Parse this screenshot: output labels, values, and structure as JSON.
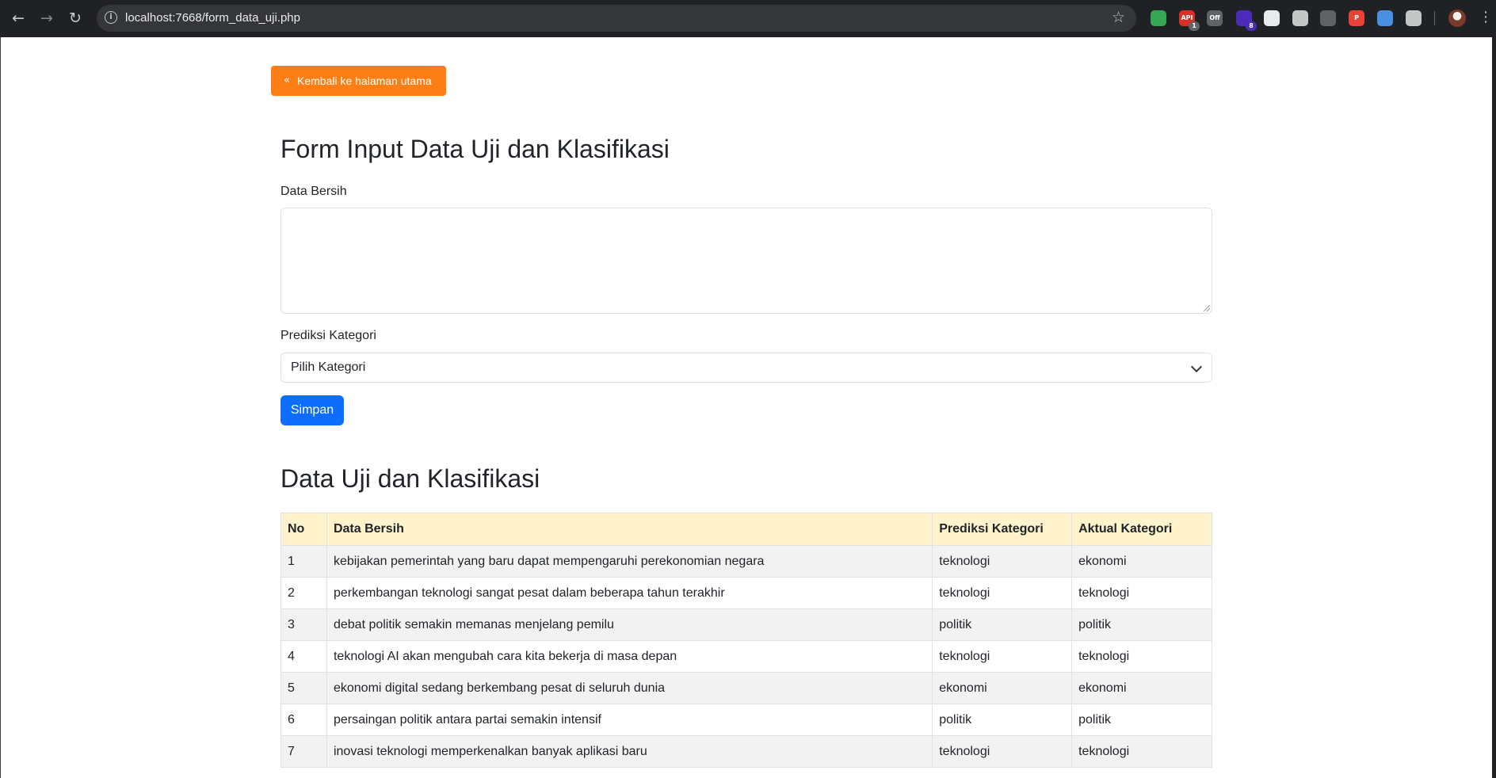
{
  "browser": {
    "url": "localhost:7668/form_data_uji.php",
    "extensions": [
      {
        "name": "green-extension",
        "color": "#34a853",
        "badge": ""
      },
      {
        "name": "api-extension",
        "color": "#d93025",
        "badge": "1",
        "label": "API"
      },
      {
        "name": "off-extension",
        "color": "#5f6368",
        "badge": "",
        "label": "Off"
      },
      {
        "name": "purple-extension",
        "color": "#4b2bb8",
        "badge": "8"
      },
      {
        "name": "terminal-extension",
        "color": "#e8eaed",
        "badge": ""
      },
      {
        "name": "target-extension",
        "color": "#c4c7c5",
        "badge": ""
      },
      {
        "name": "robot-extension",
        "color": "#5f6368",
        "badge": ""
      },
      {
        "name": "p-extension",
        "color": "#ea4335",
        "badge": "",
        "label": "P"
      },
      {
        "name": "blue-extension",
        "color": "#4a90e2",
        "badge": ""
      },
      {
        "name": "puzzle-extension",
        "color": "#c4c7c5",
        "badge": ""
      }
    ]
  },
  "back_button": {
    "label": "Kembali ke halaman utama",
    "icon": "double-chevron-left-icon",
    "color": "#fd7e14"
  },
  "form": {
    "title": "Form Input Data Uji dan Klasifikasi",
    "data_label": "Data Bersih",
    "data_value": "",
    "category_label": "Prediksi Kategori",
    "category_selected": "Pilih Kategori",
    "submit_label": "Simpan",
    "submit_color": "#0d6efd"
  },
  "table_section": {
    "title": "Data Uji dan Klasifikasi",
    "header_color": "#fff3cd",
    "columns": [
      "No",
      "Data Bersih",
      "Prediksi Kategori",
      "Aktual Kategori"
    ],
    "rows": [
      [
        "1",
        "kebijakan pemerintah yang baru dapat mempengaruhi perekonomian negara",
        "teknologi",
        "ekonomi"
      ],
      [
        "2",
        "perkembangan teknologi sangat pesat dalam beberapa tahun terakhir",
        "teknologi",
        "teknologi"
      ],
      [
        "3",
        "debat politik semakin memanas menjelang pemilu",
        "politik",
        "politik"
      ],
      [
        "4",
        "teknologi AI akan mengubah cara kita bekerja di masa depan",
        "teknologi",
        "teknologi"
      ],
      [
        "5",
        "ekonomi digital sedang berkembang pesat di seluruh dunia",
        "ekonomi",
        "ekonomi"
      ],
      [
        "6",
        "persaingan politik antara partai semakin intensif",
        "politik",
        "politik"
      ],
      [
        "7",
        "inovasi teknologi memperkenalkan banyak aplikasi baru",
        "teknologi",
        "teknologi"
      ]
    ]
  }
}
